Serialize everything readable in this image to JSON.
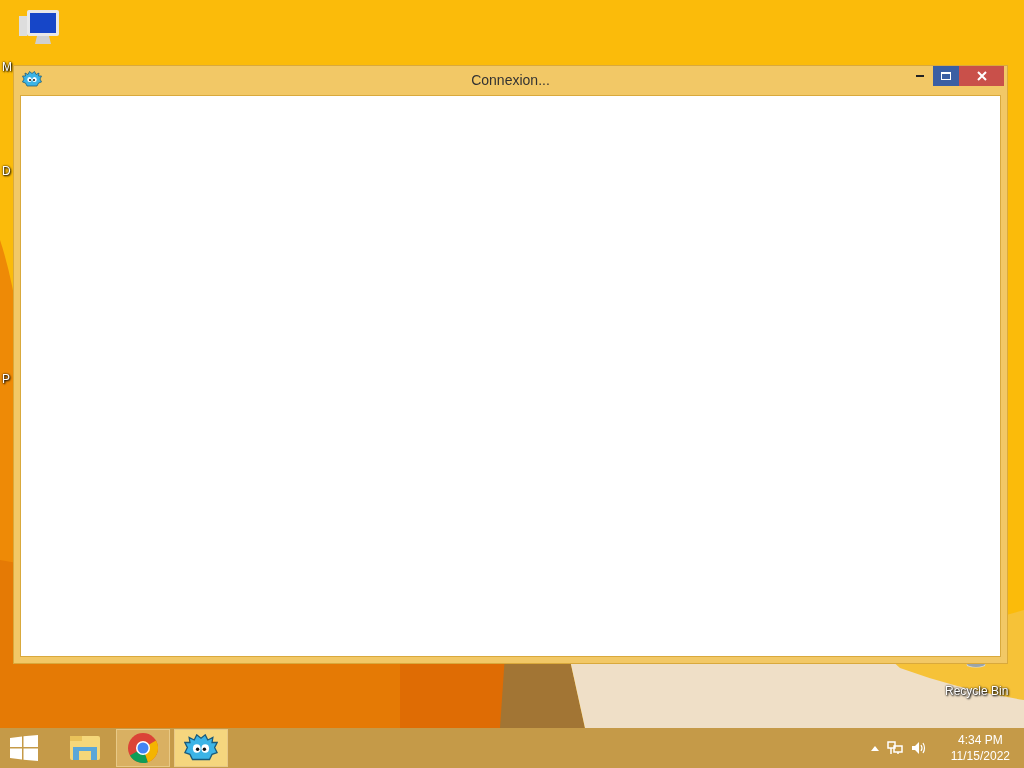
{
  "desktop_icons": [
    {
      "label": "M",
      "kind": "computer"
    },
    {
      "label": "D",
      "kind": "plain"
    },
    {
      "label": "P",
      "kind": "plain"
    },
    {
      "label": "Recycle Bin",
      "kind": "recycle"
    }
  ],
  "window": {
    "title": "Connexion..."
  },
  "taskbar": {
    "items": [
      {
        "kind": "explorer",
        "running": false,
        "selected": false
      },
      {
        "kind": "chrome",
        "running": true,
        "selected": false
      },
      {
        "kind": "puffle",
        "running": true,
        "selected": true
      }
    ],
    "clock": {
      "time": "4:34 PM",
      "date": "11/15/2022"
    }
  }
}
